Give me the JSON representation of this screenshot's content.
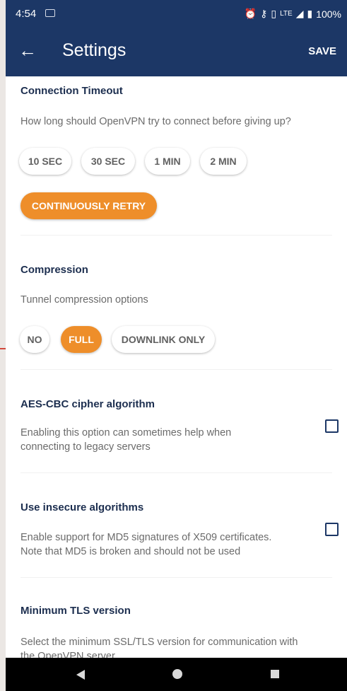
{
  "status_bar": {
    "time": "4:54",
    "icons_right": [
      "alarm-icon",
      "vpn-key-icon",
      "vibrate-icon",
      "lte-signal-icon",
      "battery-icon"
    ],
    "network": "LTE",
    "battery": "100%"
  },
  "app_bar": {
    "title": "Settings",
    "save_label": "SAVE",
    "back_icon": "arrow-back-icon"
  },
  "connection_timeout": {
    "title": "Connection Timeout",
    "description": "How long should OpenVPN try to connect before giving up?",
    "options": [
      "10 SEC",
      "30 SEC",
      "1 MIN",
      "2 MIN",
      "CONTINUOUSLY RETRY"
    ],
    "selected": "CONTINUOUSLY RETRY"
  },
  "compression": {
    "title": "Compression",
    "description": "Tunnel compression options",
    "options": [
      "NO",
      "FULL",
      "DOWNLINK ONLY"
    ],
    "selected": "FULL"
  },
  "aes_cbc": {
    "title": "AES-CBC cipher algorithm",
    "description_line1": "Enabling this option can sometimes help when",
    "description_line2": "connecting to legacy servers",
    "checked": false
  },
  "insecure": {
    "title": "Use insecure algorithms",
    "description_line1": "Enable support for MD5 signatures of X509 certificates.",
    "description_line2": "Note that MD5 is broken and should not be used",
    "checked": false
  },
  "min_tls": {
    "title": "Minimum TLS version",
    "description_line1": "Select the minimum SSL/TLS version for communication with",
    "description_line2": "the OpenVPN server"
  },
  "colors": {
    "app_bar": "#1c3766",
    "accent": "#ee8e2a",
    "section_title": "#1c2e4f"
  }
}
